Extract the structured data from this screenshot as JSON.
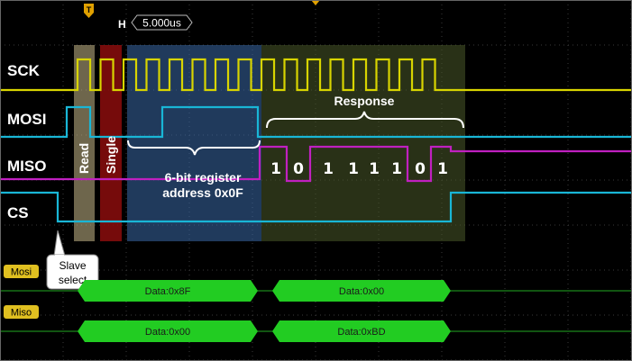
{
  "header": {
    "h_label": "H",
    "timebase": "5.000us",
    "trigger_marker": "T"
  },
  "channels": [
    {
      "name": "SCK",
      "color": "#d8d400"
    },
    {
      "name": "MOSI",
      "color": "#19b6d6"
    },
    {
      "name": "MISO",
      "color": "#c020c0"
    },
    {
      "name": "CS",
      "color": "#19b6d6"
    }
  ],
  "regions": {
    "read": "Read",
    "single": "Single",
    "address_line1": "6-bit register",
    "address_line2": "address 0x0F",
    "response": "Response"
  },
  "response_bits": [
    "1",
    "0",
    "1",
    "1",
    "1",
    "1",
    "0",
    "1"
  ],
  "callout": {
    "line1": "Slave",
    "line2": "select"
  },
  "buses": [
    {
      "tag": "Mosi",
      "segments": [
        "Data:0x8F",
        "Data:0x00"
      ]
    },
    {
      "tag": "Miso",
      "segments": [
        "Data:0x00",
        "Data:0xBD"
      ]
    }
  ],
  "colors": {
    "bus_fill": "#22cc22",
    "tag_fill": "#e0c020",
    "read_band": "#d8c890",
    "single_band": "#8b0d0d",
    "address_band": "#3a6aa8",
    "response_band": "#4a5a2a"
  }
}
